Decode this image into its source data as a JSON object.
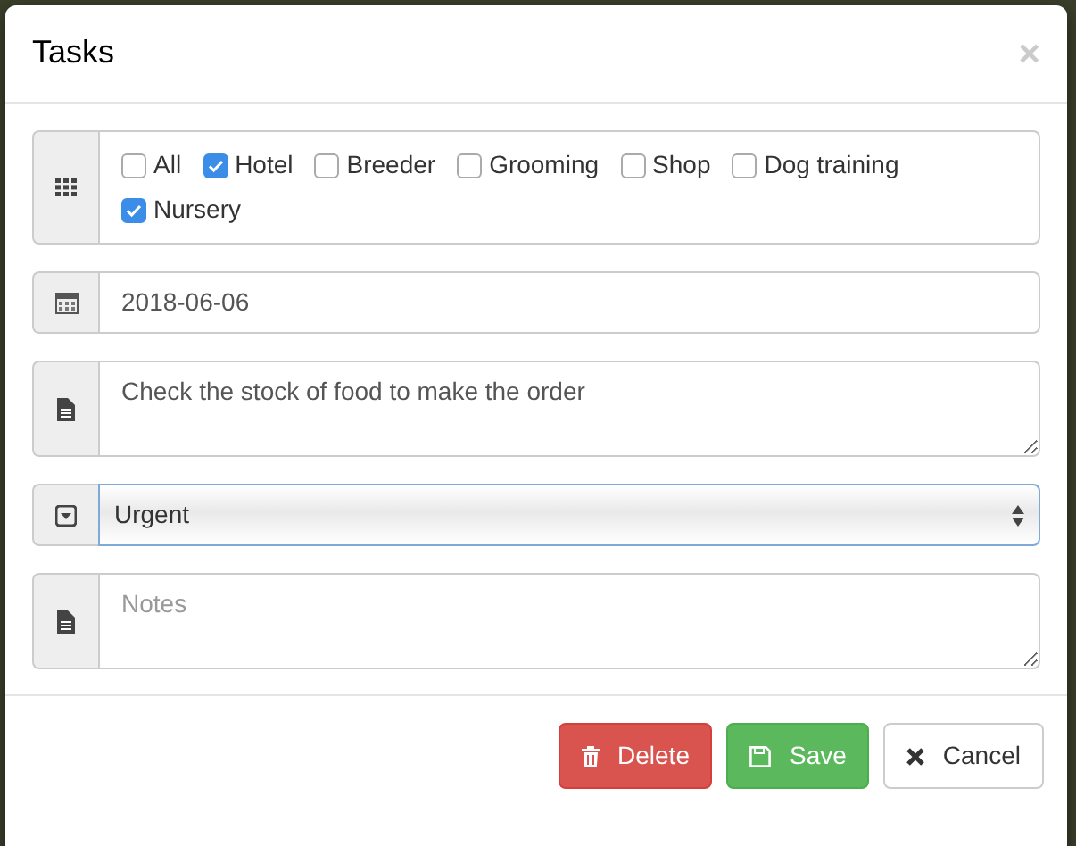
{
  "dialog": {
    "title": "Tasks",
    "close": "×"
  },
  "categories": [
    {
      "label": "All",
      "checked": false
    },
    {
      "label": "Hotel",
      "checked": true
    },
    {
      "label": "Breeder",
      "checked": false
    },
    {
      "label": "Grooming",
      "checked": false
    },
    {
      "label": "Shop",
      "checked": false
    },
    {
      "label": "Dog training",
      "checked": false
    },
    {
      "label": "Nursery",
      "checked": true
    }
  ],
  "date": {
    "value": "2018-06-06"
  },
  "description": {
    "value": "Check the stock of food to make the order"
  },
  "priority": {
    "value": "Urgent"
  },
  "notes": {
    "placeholder": "Notes"
  },
  "buttons": [
    {
      "kind": "delete",
      "label": "Delete"
    },
    {
      "kind": "save",
      "label": "Save"
    },
    {
      "kind": "cancel",
      "label": "Cancel"
    }
  ]
}
